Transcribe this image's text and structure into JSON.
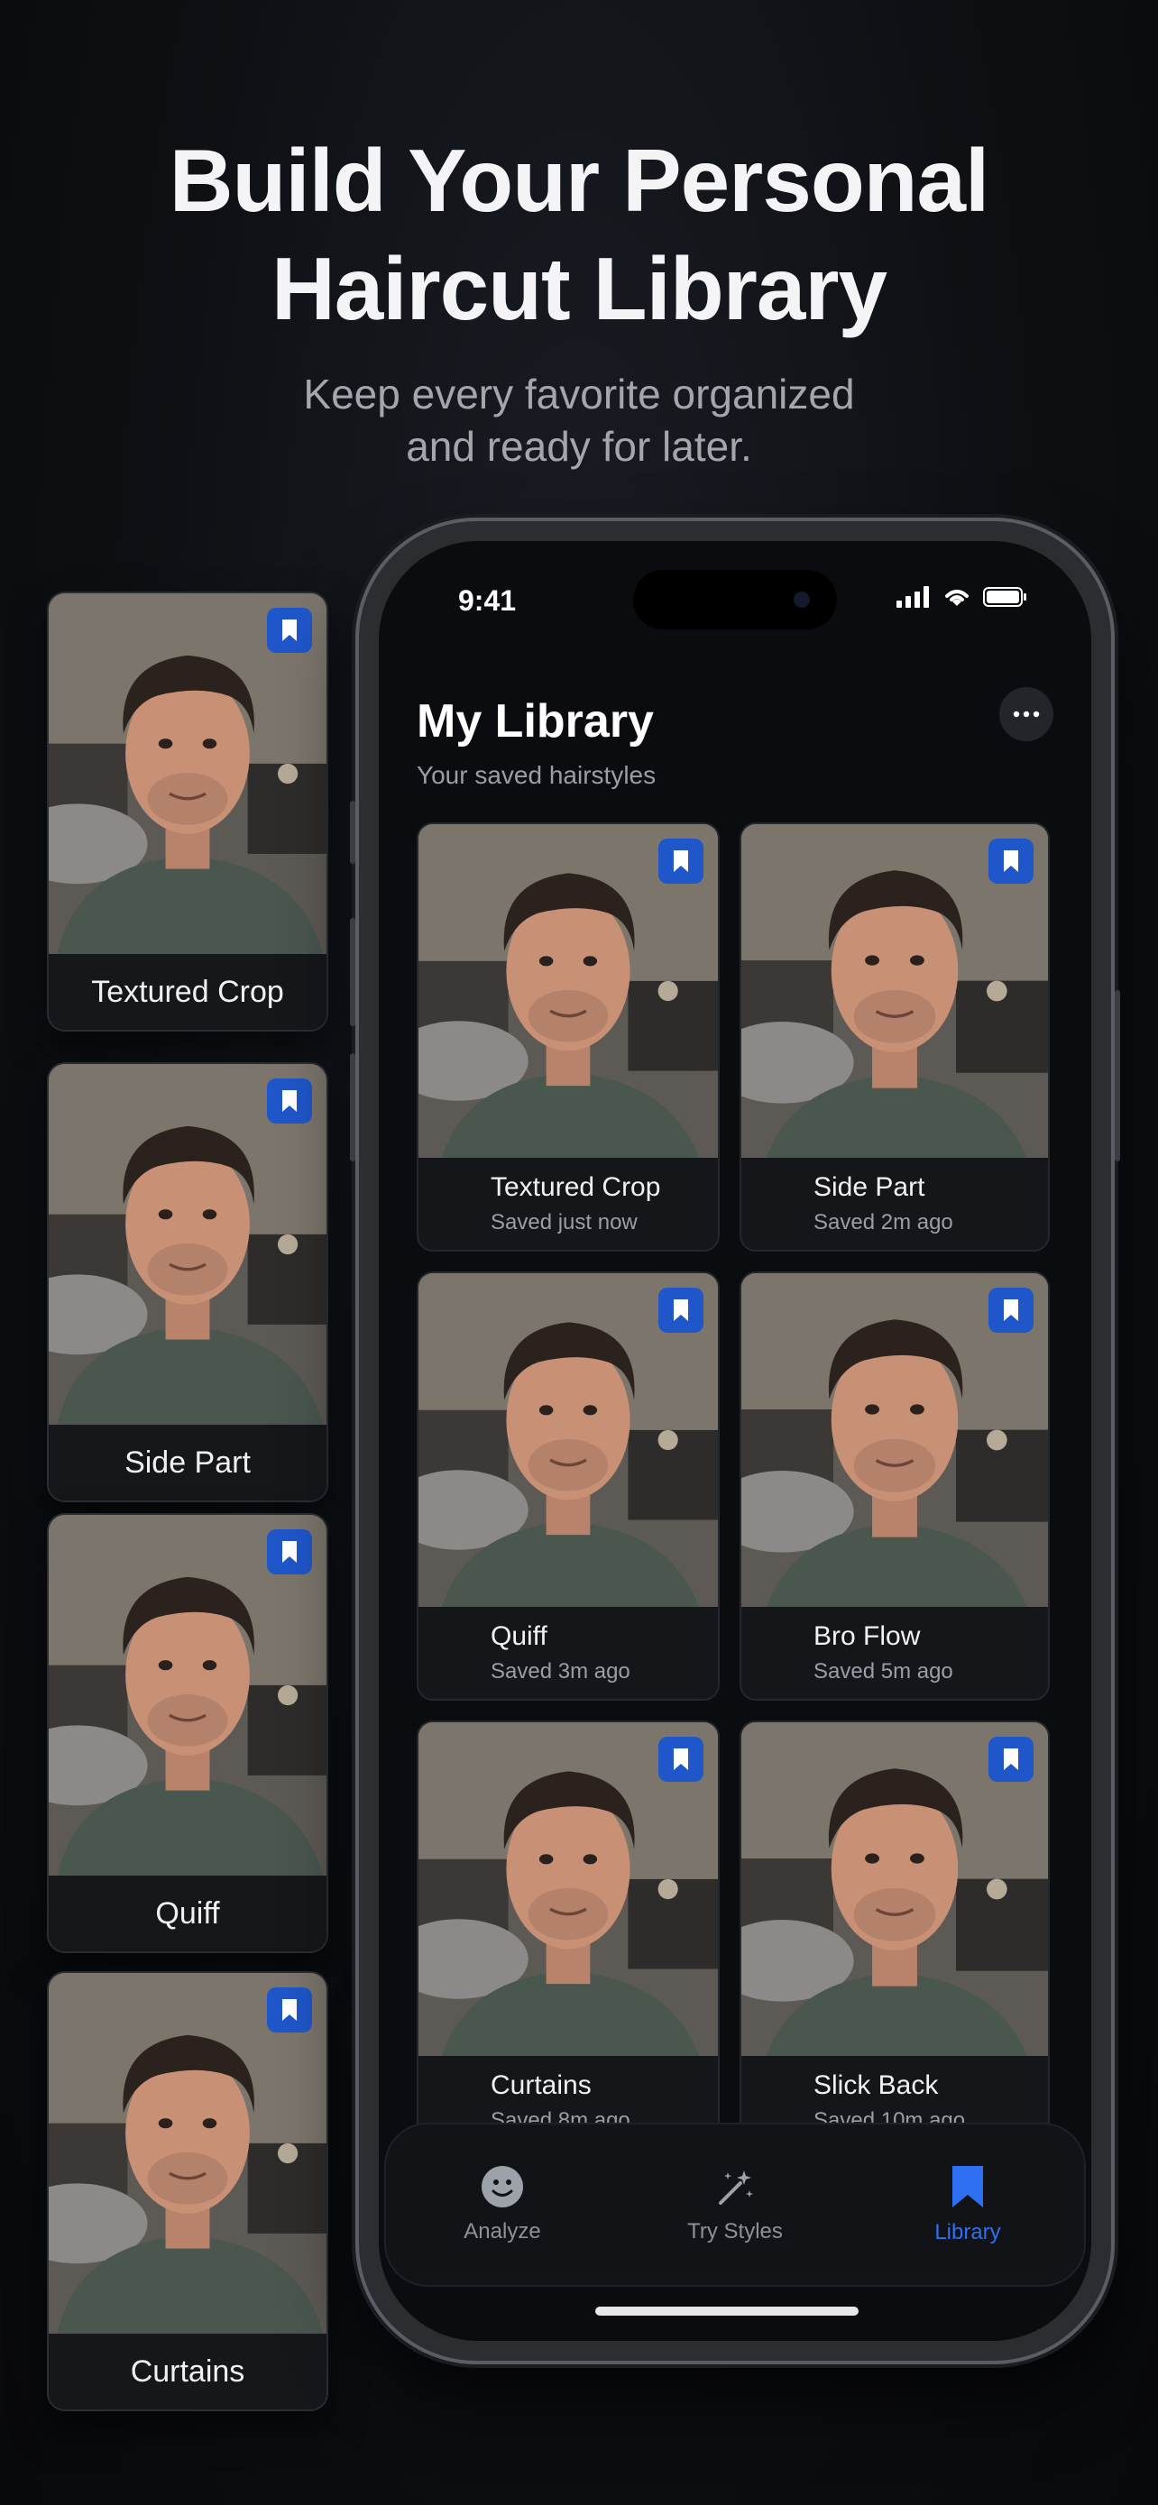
{
  "hero": {
    "title_line1": "Build Your Personal",
    "title_line2": "Haircut Library",
    "subtitle_line1": "Keep every favorite organized",
    "subtitle_line2": "and ready for later."
  },
  "side_cards": [
    {
      "label": "Textured Crop",
      "icon": "bookmark-icon"
    },
    {
      "label": "Side Part",
      "icon": "bookmark-icon"
    },
    {
      "label": "Quiff",
      "icon": "bookmark-icon"
    },
    {
      "label": "Curtains",
      "icon": "bookmark-icon"
    }
  ],
  "status_bar": {
    "time": "9:41",
    "icons": [
      "signal-icon",
      "wifi-icon",
      "battery-icon"
    ]
  },
  "library": {
    "title": "My Library",
    "subtitle": "Your saved hairstyles",
    "more_icon": "ellipsis-icon",
    "cards": [
      {
        "name": "Textured Crop",
        "saved": "Saved just now"
      },
      {
        "name": "Side Part",
        "saved": "Saved 2m ago"
      },
      {
        "name": "Quiff",
        "saved": "Saved 3m ago"
      },
      {
        "name": "Bro Flow",
        "saved": "Saved 5m ago"
      },
      {
        "name": "Curtains",
        "saved": "Saved 8m ago"
      },
      {
        "name": "Slick Back",
        "saved": "Saved 10m ago"
      }
    ]
  },
  "tabbar": {
    "tabs": [
      {
        "label": "Analyze",
        "icon": "smiley-face-icon",
        "active": false
      },
      {
        "label": "Try Styles",
        "icon": "magic-wand-icon",
        "active": false
      },
      {
        "label": "Library",
        "icon": "bookmark-icon",
        "active": true
      }
    ]
  },
  "colors": {
    "accent": "#2f6ff2",
    "bookmark_badge": "#1f56c9",
    "background": "#0d0f13"
  }
}
